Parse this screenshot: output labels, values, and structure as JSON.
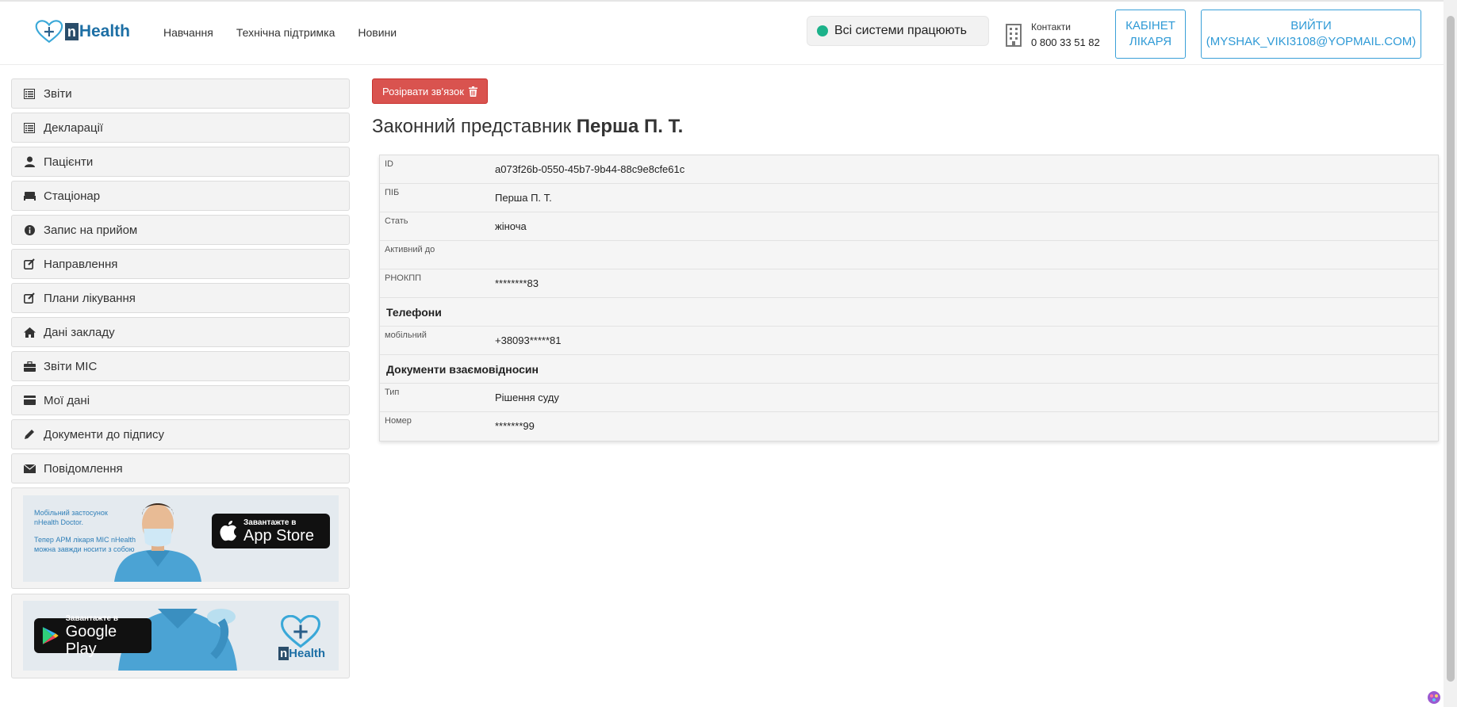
{
  "header": {
    "logo_text": "Health",
    "logo_letter": "n",
    "nav": [
      "Навчання",
      "Технічна підтримка",
      "Новини"
    ],
    "status_text": "Всі системи працюють",
    "contacts_label": "Контакти",
    "contacts_phone": "0 800 33 51 82",
    "cabinet_button_line1": "КАБІНЕТ",
    "cabinet_button_line2": "ЛІКАРЯ",
    "logout_button_line1": "ВИЙТИ",
    "logout_button_line2": "(MYSHAK_VIKI3108@YOPMAIL.COM)"
  },
  "sidebar": {
    "items": [
      {
        "label": "Звіти",
        "icon": "list-icon"
      },
      {
        "label": "Декларації",
        "icon": "list-icon"
      },
      {
        "label": "Пацієнти",
        "icon": "user-icon"
      },
      {
        "label": "Стаціонар",
        "icon": "bed-icon"
      },
      {
        "label": "Запис на прийом",
        "icon": "info-icon"
      },
      {
        "label": "Направлення",
        "icon": "edit-icon"
      },
      {
        "label": "Плани лікування",
        "icon": "edit-icon"
      },
      {
        "label": "Дані закладу",
        "icon": "home-icon"
      },
      {
        "label": "Звіти МІС",
        "icon": "briefcase-icon"
      },
      {
        "label": "Мої дані",
        "icon": "card-icon"
      },
      {
        "label": "Документи до підпису",
        "icon": "pencil-icon"
      },
      {
        "label": "Повідомлення",
        "icon": "envelope-icon"
      }
    ],
    "promo_appstore": {
      "line1": "Мобільний застосунок",
      "line2": "nHealth Doctor.",
      "line3": "Тепер АРМ лікаря МІС nHealth",
      "line4": "можна завжди носити з собою",
      "badge_small": "Завантажте в",
      "badge_big": "App Store"
    },
    "promo_googleplay": {
      "badge_small": "Завантажте в",
      "badge_big": "Google Play",
      "logo_text": "Health",
      "logo_letter": "n"
    }
  },
  "main": {
    "break_button": "Розірвати зв'язок",
    "title_prefix": "Законний представник",
    "title_name": "Перша П. Т.",
    "rows": [
      {
        "label": "ID",
        "value": "a073f26b-0550-45b7-9b44-88c9e8cfe61c"
      },
      {
        "label": "ПІБ",
        "value": "Перша П. Т."
      },
      {
        "label": "Стать",
        "value": "жіноча"
      },
      {
        "label": "Активний до",
        "value": ""
      },
      {
        "label": "РНОКПП",
        "value": "********83"
      }
    ],
    "phones_section": "Телефони",
    "phone_row": {
      "label": "мобільний",
      "value": "+38093*****81"
    },
    "docs_section": "Документи взаємовідносин",
    "doc_rows": [
      {
        "label": "Тип",
        "value": "Рішення суду"
      },
      {
        "label": "Номер",
        "value": "*******99"
      }
    ]
  },
  "colors": {
    "accent": "#2f9ad6",
    "danger": "#d9534f",
    "status_ok": "#1cb28a"
  }
}
